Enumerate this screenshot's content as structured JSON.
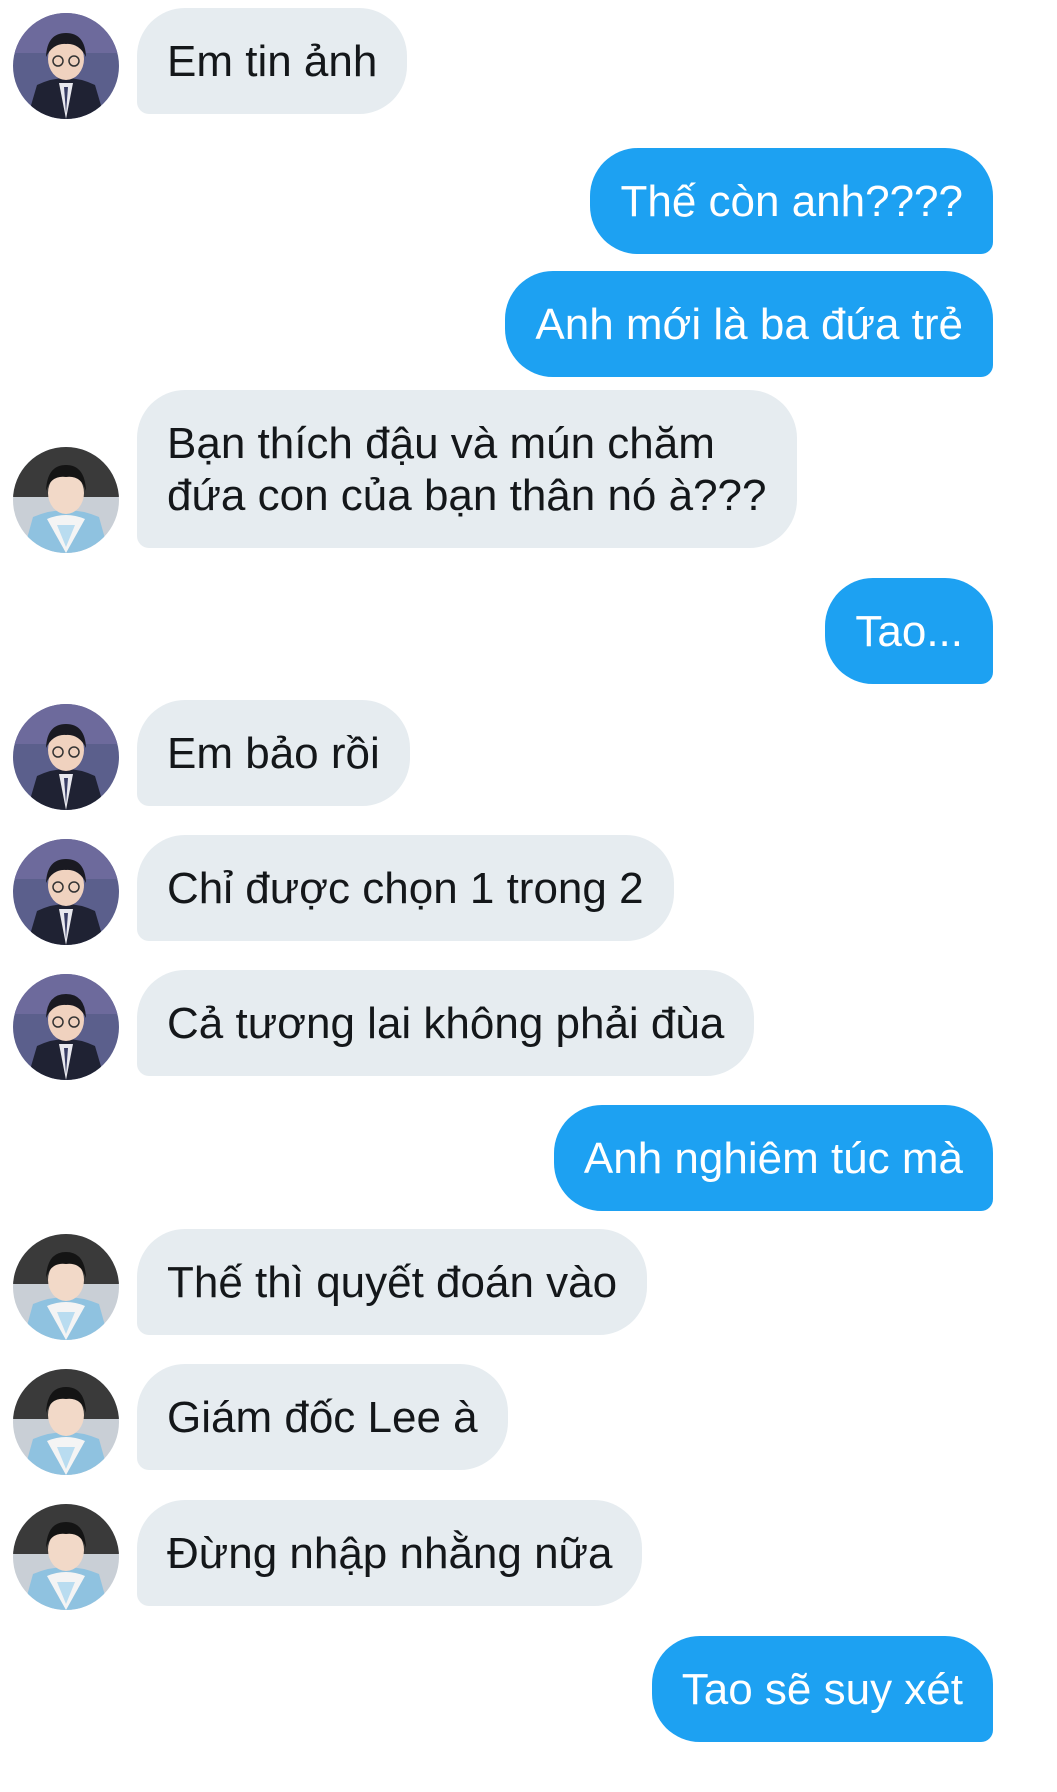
{
  "conversation": {
    "messages": [
      {
        "side": "in",
        "avatar": "avatar-suit",
        "text": "Em tin ảnh"
      },
      {
        "side": "out",
        "text": "Thế còn anh????"
      },
      {
        "side": "out",
        "text": "Anh mới là ba đứa trẻ"
      },
      {
        "side": "in",
        "avatar": "avatar-hanbok",
        "lines": [
          "Bạn thích đậu và mún chăm",
          "đứa con của bạn thân nó à???"
        ]
      },
      {
        "side": "out",
        "text": "Tao..."
      },
      {
        "side": "in",
        "avatar": "avatar-suit",
        "text": "Em bảo rồi"
      },
      {
        "side": "in",
        "avatar": "avatar-suit",
        "text": "Chỉ được chọn 1 trong 2"
      },
      {
        "side": "in",
        "avatar": "avatar-suit",
        "text": "Cả tương lai không phải đùa"
      },
      {
        "side": "out",
        "text": "Anh nghiêm túc mà"
      },
      {
        "side": "in",
        "avatar": "avatar-hanbok",
        "text": "Thế thì quyết đoán vào"
      },
      {
        "side": "in",
        "avatar": "avatar-hanbok",
        "text": "Giám đốc Lee à"
      },
      {
        "side": "in",
        "avatar": "avatar-hanbok",
        "text": "Đừng nhập nhằng nữa"
      },
      {
        "side": "out",
        "text": "Tao sẽ suy xét"
      }
    ]
  },
  "colors": {
    "incoming_bubble": "#e6ecf0",
    "incoming_text": "#14171a",
    "outgoing_bubble": "#1da1f2",
    "outgoing_text": "#ffffff"
  }
}
